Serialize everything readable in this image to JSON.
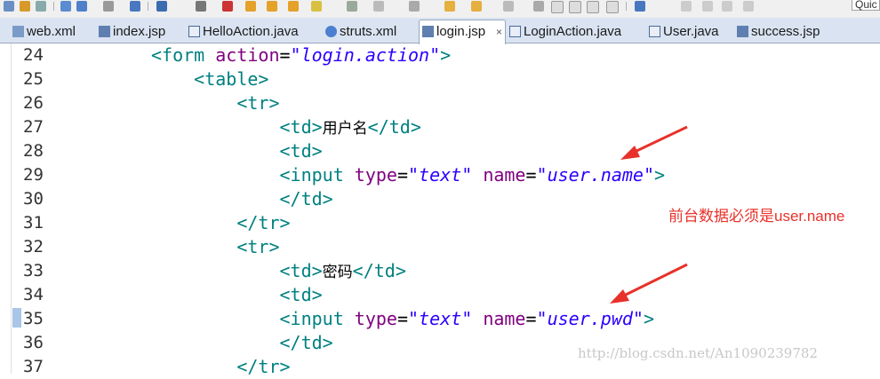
{
  "toolbar": {
    "quick_access_text": "Quic"
  },
  "tabs": [
    {
      "label": "web.xml",
      "icon": "xml-file-icon"
    },
    {
      "label": "index.jsp",
      "icon": "jsp-file-icon"
    },
    {
      "label": "HelloAction.java",
      "icon": "java-file-icon"
    },
    {
      "label": "struts.xml",
      "icon": "struts-file-icon"
    },
    {
      "label": "login.jsp",
      "icon": "jsp-file-icon",
      "active": true,
      "close": "×"
    },
    {
      "label": "LoginAction.java",
      "icon": "java-file-icon"
    },
    {
      "label": "User.java",
      "icon": "java-file-icon"
    },
    {
      "label": "success.jsp",
      "icon": "jsp-file-icon"
    }
  ],
  "editor": {
    "lines": [
      {
        "n": "24",
        "indent": "",
        "parts": [
          [
            "tag",
            "<form "
          ],
          [
            "attr",
            "action"
          ],
          [
            "eq",
            "="
          ],
          [
            "str",
            "\"login.action\""
          ],
          [
            "tag",
            ">"
          ]
        ]
      },
      {
        "n": "25",
        "indent": "    ",
        "parts": [
          [
            "tag",
            "<table>"
          ]
        ]
      },
      {
        "n": "26",
        "indent": "        ",
        "parts": [
          [
            "tag",
            "<tr>"
          ]
        ]
      },
      {
        "n": "27",
        "indent": "            ",
        "parts": [
          [
            "tag",
            "<td>"
          ],
          [
            "txt",
            "用户名"
          ],
          [
            "tag",
            "</td>"
          ]
        ]
      },
      {
        "n": "28",
        "indent": "            ",
        "parts": [
          [
            "tag",
            "<td>"
          ]
        ]
      },
      {
        "n": "29",
        "indent": "            ",
        "parts": [
          [
            "tag",
            "<input "
          ],
          [
            "attr",
            "type"
          ],
          [
            "eq",
            "="
          ],
          [
            "str",
            "\"text\""
          ],
          [
            "eq",
            " "
          ],
          [
            "attr",
            "name"
          ],
          [
            "eq",
            "="
          ],
          [
            "str",
            "\"user.name\""
          ],
          [
            "tag",
            ">"
          ]
        ]
      },
      {
        "n": "30",
        "indent": "            ",
        "parts": [
          [
            "tag",
            "</td>"
          ]
        ]
      },
      {
        "n": "31",
        "indent": "        ",
        "parts": [
          [
            "tag",
            "</tr>"
          ]
        ]
      },
      {
        "n": "32",
        "indent": "        ",
        "parts": [
          [
            "tag",
            "<tr>"
          ]
        ]
      },
      {
        "n": "33",
        "indent": "            ",
        "parts": [
          [
            "tag",
            "<td>"
          ],
          [
            "txt",
            "密码"
          ],
          [
            "tag",
            "</td>"
          ]
        ]
      },
      {
        "n": "34",
        "indent": "            ",
        "parts": [
          [
            "tag",
            "<td>"
          ]
        ]
      },
      {
        "n": "35",
        "indent": "            ",
        "parts": [
          [
            "tag",
            "<input "
          ],
          [
            "attr",
            "type"
          ],
          [
            "eq",
            "="
          ],
          [
            "str",
            "\"text\""
          ],
          [
            "eq",
            " "
          ],
          [
            "attr",
            "name"
          ],
          [
            "eq",
            "="
          ],
          [
            "str",
            "\"user.pwd\""
          ],
          [
            "tag",
            ">"
          ]
        ]
      },
      {
        "n": "36",
        "indent": "            ",
        "parts": [
          [
            "tag",
            "</td>"
          ]
        ]
      },
      {
        "n": "37",
        "indent": "        ",
        "parts": [
          [
            "tag",
            "</tr>"
          ]
        ]
      }
    ]
  },
  "annotation": {
    "text": "前台数据必须是user.name",
    "color": "#e8312a"
  },
  "watermark": {
    "text": "http://blog.csdn.net/An1090239782"
  },
  "colors": {
    "tag": "#008080",
    "attr": "#7f007f",
    "string": "#2a00ff",
    "tabbar": "#dae3f1"
  }
}
